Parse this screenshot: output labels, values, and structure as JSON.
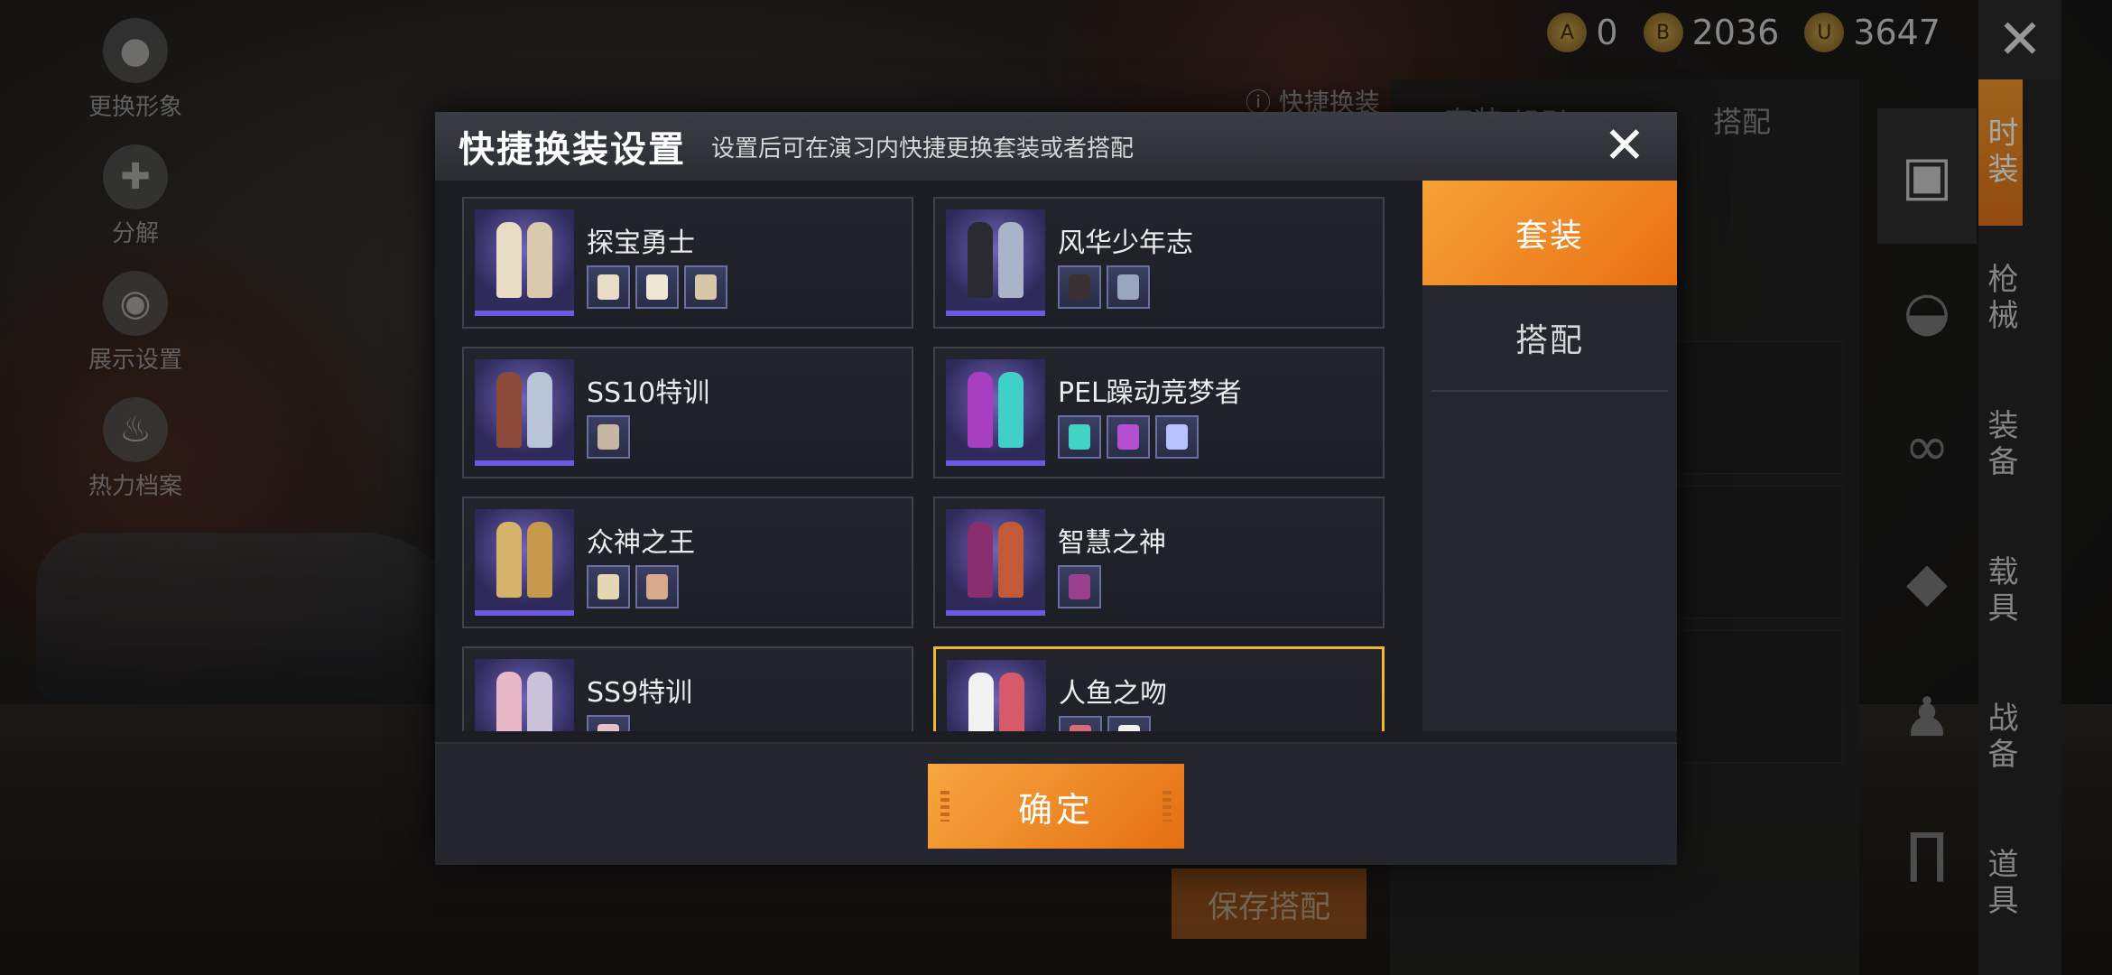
{
  "left_menu": [
    {
      "label": "更换形象",
      "icon": "person-icon"
    },
    {
      "label": "分解",
      "icon": "puzzle-icon"
    },
    {
      "label": "展示设置",
      "icon": "eye-icon"
    },
    {
      "label": "热力档案",
      "icon": "fire-icon"
    }
  ],
  "currency": {
    "c1": "0",
    "c2": "2036",
    "c3": "3647"
  },
  "categories": [
    "时装",
    "枪械",
    "装备",
    "载具",
    "战备",
    "道具"
  ],
  "underlying": {
    "quick_hint": "快捷换装",
    "tab_suit": "套装 (55)",
    "tab_match": "搭配",
    "save": "保存搭配"
  },
  "modal": {
    "title": "快捷换装设置",
    "subtitle": "设置后可在演习内快捷更换套装或者搭配",
    "side_tabs": [
      "套装",
      "搭配"
    ],
    "confirm": "确定",
    "outfits": [
      {
        "name": "探宝勇士",
        "minis": 3
      },
      {
        "name": "风华少年志",
        "minis": 2
      },
      {
        "name": "SS10特训",
        "minis": 1
      },
      {
        "name": "PEL躁动竞梦者",
        "minis": 3
      },
      {
        "name": "众神之王",
        "minis": 2
      },
      {
        "name": "智慧之神",
        "minis": 1
      },
      {
        "name": "SS9特训",
        "minis": 1
      },
      {
        "name": "人鱼之吻",
        "minis": 2
      }
    ]
  }
}
